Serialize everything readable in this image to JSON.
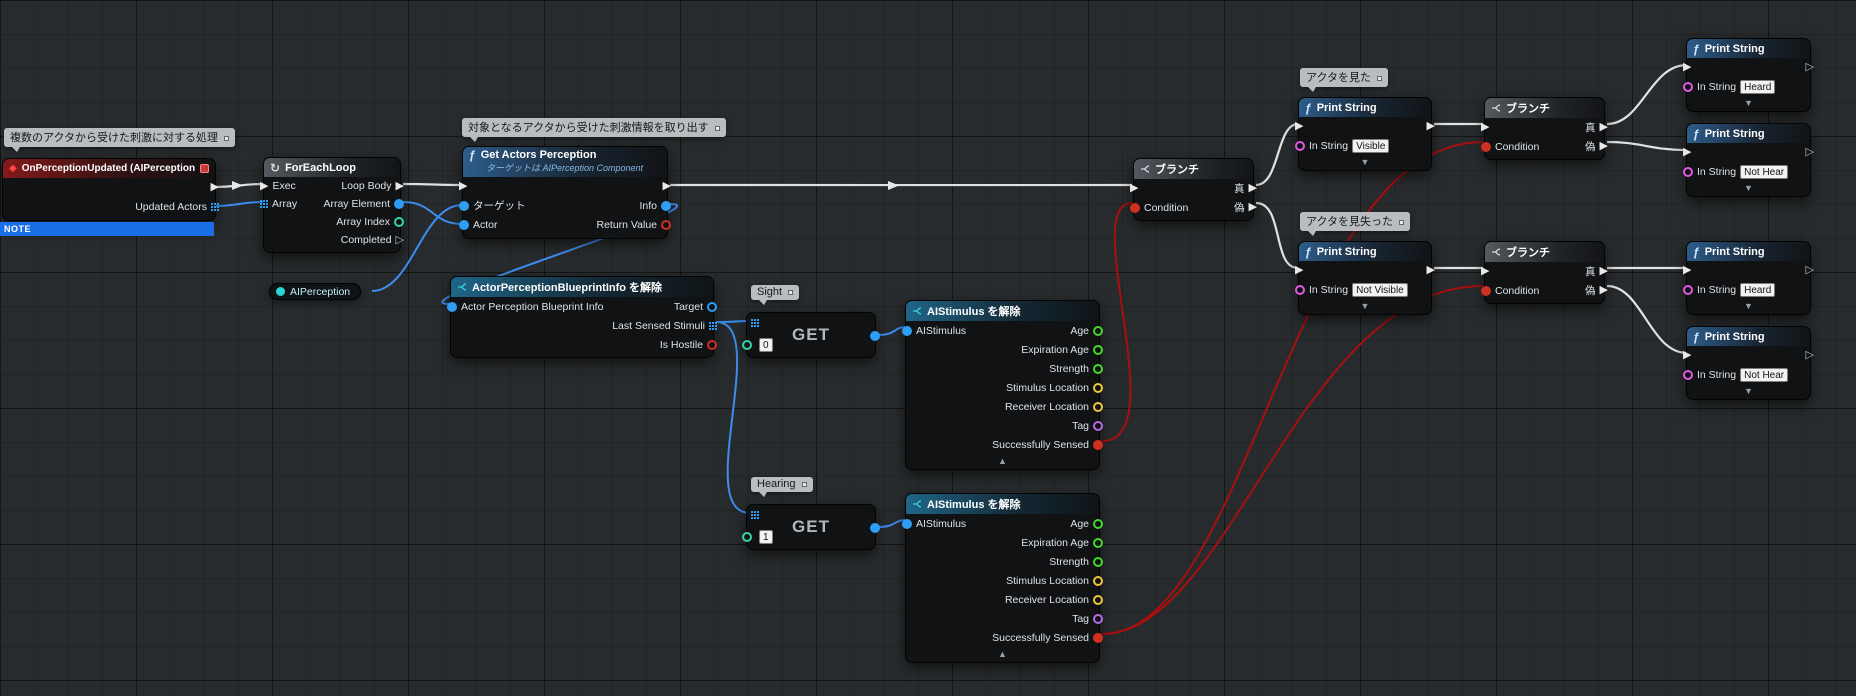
{
  "canvas": {
    "background": "#282b2d"
  },
  "palette": {
    "exec_pin": "#e8e8e8",
    "object_pin": "#2f9df4",
    "bool_pin": "#d0301f",
    "float_pin": "#44d62c",
    "vector_pin": "#efc43a",
    "string_pin": "#e05ae0",
    "name_pin": "#b66ae8",
    "int_pin": "#30d5a8",
    "component_pin": "#2ad4d4",
    "exec_wire": "#dfe2e4",
    "data_wire": "#3c8df0",
    "bool_wire": "#a80f0f",
    "note_bar": "#1a6fe8",
    "event_header": "#8a1a1a",
    "function_header": "#2f6192",
    "macro_header": "#5a6066"
  },
  "comments": {
    "multi_actor": "複数のアクタから受けた刺激に対する処理",
    "extract_stimulus": "対象となるアクタから受けた刺激情報を取り出す",
    "saw_actor": "アクタを見た",
    "lost_actor": "アクタを見失った",
    "sight": "Sight",
    "hearing": "Hearing"
  },
  "event_node": {
    "title": "OnPerceptionUpdated (AIPerception)",
    "updated_actors": "Updated Actors",
    "note": "NOTE"
  },
  "foreach_node": {
    "title": "ForEachLoop",
    "exec": "Exec",
    "array": "Array",
    "loop_body": "Loop Body",
    "array_element": "Array Element",
    "array_index": "Array Index",
    "completed": "Completed"
  },
  "get_actors_perception": {
    "title": "Get Actors Perception",
    "subtitle": "ターゲットは AIPerception Component",
    "target": "ターゲット",
    "actor": "Actor",
    "info": "Info",
    "return_value": "Return Value"
  },
  "aiperception_var": {
    "label": "AIPerception"
  },
  "break_info_node": {
    "title": "ActorPerceptionBlueprintInfo を解除",
    "input": "Actor Perception Blueprint Info",
    "target": "Target",
    "last_sensed_stimuli": "Last Sensed Stimuli",
    "is_hostile": "Is Hostile"
  },
  "get_nodes": {
    "label": "GET",
    "sight_index": "0",
    "hearing_index": "1"
  },
  "break_stimulus_node": {
    "title": "AIStimulus を解除",
    "input": "AIStimulus",
    "age": "Age",
    "expiration_age": "Expiration Age",
    "strength": "Strength",
    "stimulus_location": "Stimulus Location",
    "receiver_location": "Receiver Location",
    "tag": "Tag",
    "successfully_sensed": "Successfully Sensed"
  },
  "branch_node": {
    "title": "ブランチ",
    "condition": "Condition",
    "true_label": "真",
    "false_label": "偽"
  },
  "print_string": {
    "title": "Print String",
    "in_string": "In String",
    "values": {
      "visible": "Visible",
      "not_visible": "Not Visible",
      "heard": "Heard",
      "not_hear": "Not Hear"
    }
  }
}
